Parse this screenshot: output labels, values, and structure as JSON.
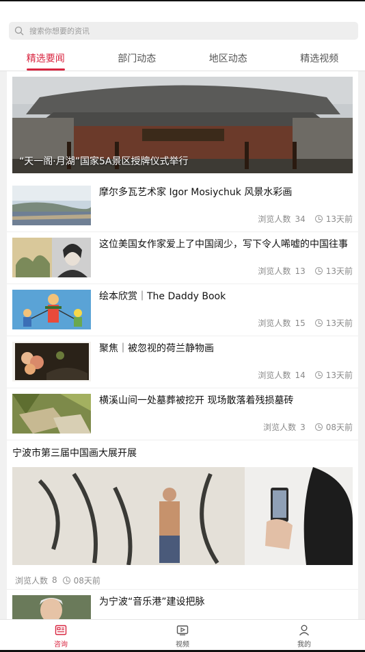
{
  "search": {
    "placeholder": "搜索你想要的资讯"
  },
  "tabs": [
    {
      "label": "精选要闻",
      "active": true
    },
    {
      "label": "部门动态",
      "active": false
    },
    {
      "label": "地区动态",
      "active": false
    },
    {
      "label": "精选视频",
      "active": false
    }
  ],
  "hero": {
    "caption": "“天一阁·月湖”国家5A景区授牌仪式举行"
  },
  "meta_labels": {
    "views": "浏览人数"
  },
  "items": [
    {
      "title": "摩尔多瓦艺术家 Igor Mosiychuk 风景水彩画",
      "views": "34",
      "time": "13天前"
    },
    {
      "title": "这位美国女作家爱上了中国阔少，写下令人唏嘘的中国往事",
      "views": "13",
      "time": "13天前"
    },
    {
      "title": "绘本欣赏｜The Daddy Book",
      "views": "15",
      "time": "13天前"
    },
    {
      "title": "聚焦｜被忽视的荷兰静物画",
      "views": "14",
      "time": "13天前"
    },
    {
      "title": "横溪山间一处墓葬被挖开 现场散落着残损墓砖",
      "views": "3",
      "time": "08天前"
    }
  ],
  "big_item": {
    "title": "宁波市第三届中国画大展开展",
    "views": "8",
    "time": "08天前"
  },
  "last_item": {
    "title": "为宁波“音乐港”建设把脉"
  },
  "bottom_nav": [
    {
      "label": "咨询",
      "icon": "news-icon",
      "active": true
    },
    {
      "label": "视频",
      "icon": "video-icon",
      "active": false
    },
    {
      "label": "我的",
      "icon": "user-icon",
      "active": false
    }
  ],
  "colors": {
    "accent": "#d8243f"
  }
}
